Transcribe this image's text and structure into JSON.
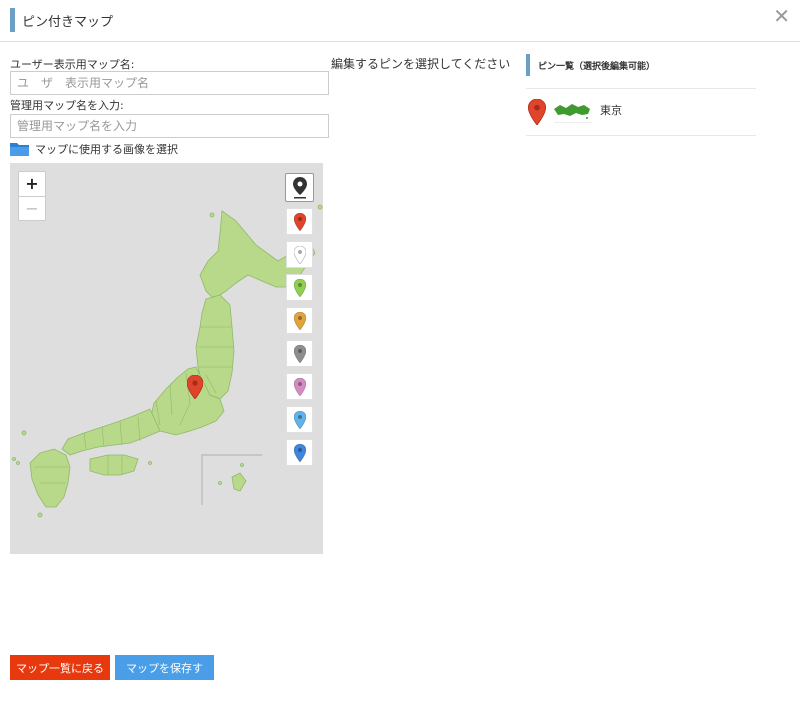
{
  "window": {
    "title": "ピン付きマップ",
    "close_glyph": "✕"
  },
  "form": {
    "user_map_name_label": "ユーザー表示用マップ名:",
    "user_map_name_placeholder": "ユ　ザ　表示用マップ名",
    "admin_map_name_label": "管理用マップ名を入力:",
    "admin_map_name_placeholder": "管理用マップ名を入力",
    "image_select_label": "マップに使用する画像を選択"
  },
  "map": {
    "zoom_in": "+",
    "zoom_out": "−",
    "land_color": "#b9d98a",
    "water_color": "#dedede",
    "pin_colors": [
      "#e0452b",
      "#ffffff",
      "#8fd14f",
      "#e2a33a",
      "#8e8e8e",
      "#d68cc2",
      "#5db3ea",
      "#3f86de"
    ],
    "placed_pin_color": "#e0452b"
  },
  "editor": {
    "message": "編集するピンを選択してください"
  },
  "pin_list": {
    "title": "ピン一覧（選択後編集可能）",
    "items": [
      {
        "name": "東京",
        "color": "#e0452b"
      }
    ]
  },
  "actions": {
    "back_label": "マップ一覧に戻る",
    "back_color": "#e8380d",
    "save_label": "マップを保存する",
    "save_color": "#4a9ee8"
  }
}
